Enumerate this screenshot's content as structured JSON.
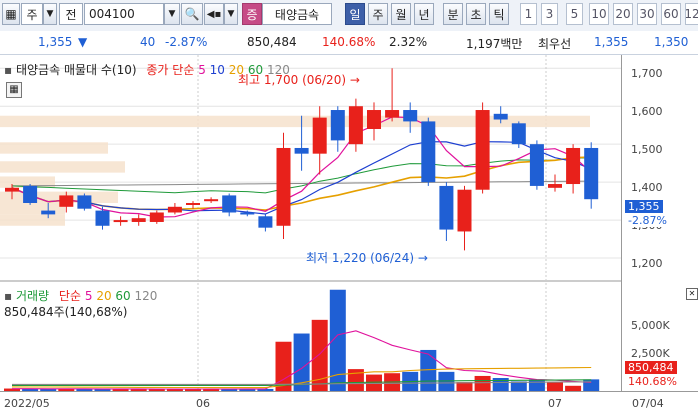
{
  "toolbar": {
    "mode": "주",
    "prev_label": "전",
    "code": "004100",
    "sound": "◀▪",
    "mark": "증",
    "stock_name": "태양금속",
    "period_labels": [
      "일",
      "주",
      "월",
      "년",
      "분",
      "초",
      "틱"
    ],
    "minute_options": [
      "1",
      "3",
      "5",
      "10",
      "20",
      "30",
      "60",
      "12"
    ]
  },
  "info": {
    "price": "1,355",
    "arrow": "▼",
    "change": "40",
    "change_pct": "-2.87%",
    "volume": "850,484",
    "vol_ratio": "140.68%",
    "turnover_pct": "2.32%",
    "trade_value": "1,197백만",
    "best_label": "최우선",
    "best_ask": "1,355",
    "best_bid": "1,350"
  },
  "price_panel": {
    "legend_title": "태양금속 매물대 수(10)",
    "ma_label": "종가 단순",
    "ma_periods": [
      "5",
      "10",
      "20",
      "60",
      "120"
    ],
    "max_annotation": "최고 1,700 (06/20)",
    "min_annotation": "최저 1,220 (06/24)",
    "ticks": [
      "1,700",
      "1,600",
      "1,500",
      "1,400",
      "1,300",
      "1,200"
    ],
    "current_price_tag": "1,355",
    "current_pct_tag": "-2.87%"
  },
  "volume_panel": {
    "legend_title": "거래량",
    "ma_label": "단순",
    "ma_periods": [
      "5",
      "20",
      "60",
      "120"
    ],
    "current_text": "850,484주(140,68%)",
    "ticks": [
      "5,000K",
      "2,500K"
    ],
    "tag_value": "850,484",
    "tag_pct": "140.68%"
  },
  "x_labels": [
    "2022/05",
    "06",
    "07",
    "07/04"
  ],
  "colors": {
    "up": "#e8211b",
    "down": "#1f5fd4",
    "ma5": "#e0129c",
    "ma10": "#1d3fd0",
    "ma20": "#e6a000",
    "ma60": "#1f9a3a",
    "ma120": "#888888",
    "volume_profile": "#f6e2cc"
  },
  "chart_data": {
    "type": "candlestick",
    "price_axis": {
      "ticks": [
        1200,
        1300,
        1400,
        1500,
        1600,
        1700
      ],
      "ylim": [
        1150,
        1735
      ]
    },
    "candles": [
      {
        "o": 1375,
        "c": 1385,
        "h": 1395,
        "l": 1355
      },
      {
        "o": 1390,
        "c": 1345,
        "h": 1395,
        "l": 1340
      },
      {
        "o": 1325,
        "c": 1315,
        "h": 1345,
        "l": 1305
      },
      {
        "o": 1335,
        "c": 1365,
        "h": 1375,
        "l": 1320
      },
      {
        "o": 1365,
        "c": 1330,
        "h": 1370,
        "l": 1325
      },
      {
        "o": 1325,
        "c": 1285,
        "h": 1335,
        "l": 1275
      },
      {
        "o": 1295,
        "c": 1300,
        "h": 1310,
        "l": 1285
      },
      {
        "o": 1295,
        "c": 1305,
        "h": 1315,
        "l": 1285
      },
      {
        "o": 1295,
        "c": 1320,
        "h": 1325,
        "l": 1290
      },
      {
        "o": 1320,
        "c": 1335,
        "h": 1345,
        "l": 1315
      },
      {
        "o": 1340,
        "c": 1345,
        "h": 1350,
        "l": 1330
      },
      {
        "o": 1355,
        "c": 1355,
        "h": 1360,
        "l": 1345
      },
      {
        "o": 1365,
        "c": 1320,
        "h": 1370,
        "l": 1310
      },
      {
        "o": 1320,
        "c": 1315,
        "h": 1325,
        "l": 1310
      },
      {
        "o": 1310,
        "c": 1280,
        "h": 1315,
        "l": 1270
      },
      {
        "o": 1285,
        "c": 1490,
        "h": 1530,
        "l": 1250
      },
      {
        "o": 1490,
        "c": 1475,
        "h": 1575,
        "l": 1430
      },
      {
        "o": 1475,
        "c": 1570,
        "h": 1600,
        "l": 1420
      },
      {
        "o": 1590,
        "c": 1510,
        "h": 1600,
        "l": 1480
      },
      {
        "o": 1500,
        "c": 1600,
        "h": 1620,
        "l": 1480
      },
      {
        "o": 1540,
        "c": 1590,
        "h": 1610,
        "l": 1510
      },
      {
        "o": 1570,
        "c": 1590,
        "h": 1700,
        "l": 1560
      },
      {
        "o": 1590,
        "c": 1560,
        "h": 1610,
        "l": 1530
      },
      {
        "o": 1560,
        "c": 1400,
        "h": 1570,
        "l": 1390
      },
      {
        "o": 1390,
        "c": 1275,
        "h": 1400,
        "l": 1245
      },
      {
        "o": 1270,
        "c": 1380,
        "h": 1390,
        "l": 1220
      },
      {
        "o": 1380,
        "c": 1590,
        "h": 1610,
        "l": 1370
      },
      {
        "o": 1580,
        "c": 1565,
        "h": 1600,
        "l": 1555
      },
      {
        "o": 1555,
        "c": 1500,
        "h": 1560,
        "l": 1490
      },
      {
        "o": 1500,
        "c": 1390,
        "h": 1510,
        "l": 1380
      },
      {
        "o": 1385,
        "c": 1395,
        "h": 1420,
        "l": 1375
      },
      {
        "o": 1395,
        "c": 1490,
        "h": 1500,
        "l": 1370
      },
      {
        "o": 1490,
        "c": 1355,
        "h": 1505,
        "l": 1330
      }
    ],
    "volume_axis": {
      "ticks": [
        2500,
        5000
      ],
      "unit": "K",
      "ylim": [
        0,
        7600
      ]
    },
    "volumes": [
      180,
      170,
      150,
      160,
      150,
      150,
      140,
      140,
      140,
      140,
      150,
      150,
      160,
      150,
      150,
      3600,
      4200,
      5200,
      7400,
      1600,
      1200,
      1300,
      1400,
      3000,
      1400,
      650,
      1100,
      950,
      700,
      850,
      620,
      380,
      850
    ],
    "volume_ma": [
      {
        "name": "5",
        "color": "#e0129c",
        "values": [
          170,
          165,
          160,
          160,
          158,
          155,
          150,
          150,
          145,
          145,
          145,
          145,
          148,
          150,
          150,
          850,
          1650,
          2700,
          4100,
          4400,
          3900,
          3340,
          3000,
          2700,
          1700,
          1500,
          1450,
          1200,
          1000,
          830,
          800,
          700,
          620
        ]
      },
      {
        "name": "20",
        "color": "#e6a000",
        "values": [
          300,
          295,
          290,
          285,
          280,
          275,
          270,
          265,
          260,
          258,
          255,
          252,
          250,
          248,
          246,
          400,
          600,
          850,
          1200,
          1300,
          1400,
          1400,
          1500,
          1560,
          1600,
          1620,
          1640,
          1650,
          1660,
          1670,
          1690,
          1700,
          1720
        ]
      },
      {
        "name": "60",
        "color": "#1f9a3a",
        "values": [
          400,
          400,
          400,
          400,
          400,
          400,
          400,
          400,
          400,
          400,
          400,
          400,
          400,
          400,
          400,
          430,
          470,
          520,
          600,
          620,
          640,
          660,
          690,
          720,
          740,
          750,
          760,
          770,
          780,
          790,
          800,
          810,
          820
        ]
      },
      {
        "name": "120",
        "color": "#888888",
        "values": [
          480,
          480,
          480,
          480,
          480,
          480,
          480,
          480,
          480,
          480,
          480,
          480,
          480,
          480,
          480,
          490,
          500,
          510,
          530,
          540,
          550,
          560,
          570,
          580,
          590,
          600,
          610,
          620,
          630,
          640,
          650,
          660,
          670
        ]
      }
    ]
  }
}
